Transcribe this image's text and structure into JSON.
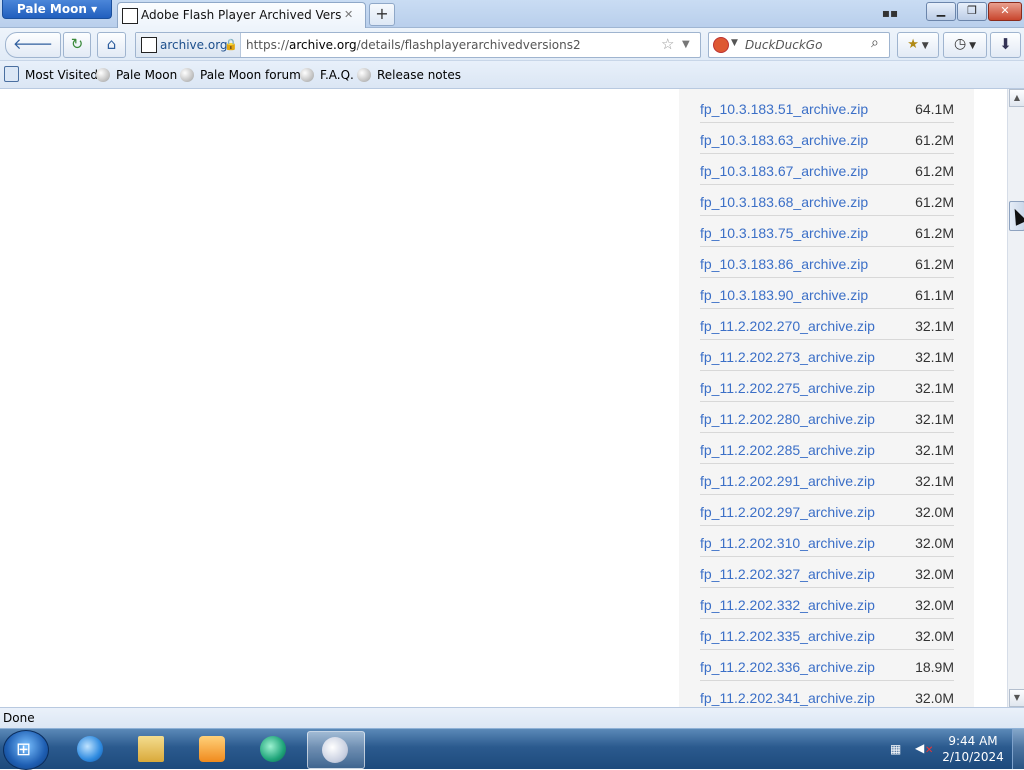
{
  "browser": {
    "app_menu_label": "Pale Moon",
    "tab_title": "Adobe Flash Player Archived Versions :",
    "new_tab_label": "+",
    "url_identity": "archive.org",
    "url_prefix": "https://",
    "url_host": "archive.org",
    "url_path": "/details/flashplayerarchivedversions2",
    "search_placeholder": "DuckDuckGo",
    "bookmarks": [
      "Most Visited",
      "Pale Moon",
      "Pale Moon forum",
      "F.A.Q.",
      "Release notes"
    ],
    "status": "Done"
  },
  "files": [
    {
      "name": "fp_10.3.183.51_archive.zip",
      "size": "64.1M"
    },
    {
      "name": "fp_10.3.183.63_archive.zip",
      "size": "61.2M"
    },
    {
      "name": "fp_10.3.183.67_archive.zip",
      "size": "61.2M"
    },
    {
      "name": "fp_10.3.183.68_archive.zip",
      "size": "61.2M"
    },
    {
      "name": "fp_10.3.183.75_archive.zip",
      "size": "61.2M"
    },
    {
      "name": "fp_10.3.183.86_archive.zip",
      "size": "61.2M"
    },
    {
      "name": "fp_10.3.183.90_archive.zip",
      "size": "61.1M"
    },
    {
      "name": "fp_11.2.202.270_archive.zip",
      "size": "32.1M"
    },
    {
      "name": "fp_11.2.202.273_archive.zip",
      "size": "32.1M"
    },
    {
      "name": "fp_11.2.202.275_archive.zip",
      "size": "32.1M"
    },
    {
      "name": "fp_11.2.202.280_archive.zip",
      "size": "32.1M"
    },
    {
      "name": "fp_11.2.202.285_archive.zip",
      "size": "32.1M"
    },
    {
      "name": "fp_11.2.202.291_archive.zip",
      "size": "32.1M"
    },
    {
      "name": "fp_11.2.202.297_archive.zip",
      "size": "32.0M"
    },
    {
      "name": "fp_11.2.202.310_archive.zip",
      "size": "32.0M"
    },
    {
      "name": "fp_11.2.202.327_archive.zip",
      "size": "32.0M"
    },
    {
      "name": "fp_11.2.202.332_archive.zip",
      "size": "32.0M"
    },
    {
      "name": "fp_11.2.202.335_archive.zip",
      "size": "32.0M"
    },
    {
      "name": "fp_11.2.202.336_archive.zip",
      "size": "18.9M"
    },
    {
      "name": "fp_11.2.202.341_archive.zip",
      "size": "32.0M"
    }
  ],
  "taskbar": {
    "time": "9:44 AM",
    "date": "2/10/2024"
  },
  "icons": {
    "back": "back-arrow-icon",
    "forward": "forward-arrow-icon",
    "reload": "reload-icon",
    "home": "home-icon",
    "lock": "lock-icon",
    "star": "bookmark-star-icon",
    "search": "magnifier-icon",
    "downloads": "download-arrow-icon",
    "history": "clock-icon"
  },
  "colors": {
    "link": "#3b6fc7",
    "panel_bg": "#f5f5f5",
    "chrome_accent": "#215fbe"
  }
}
